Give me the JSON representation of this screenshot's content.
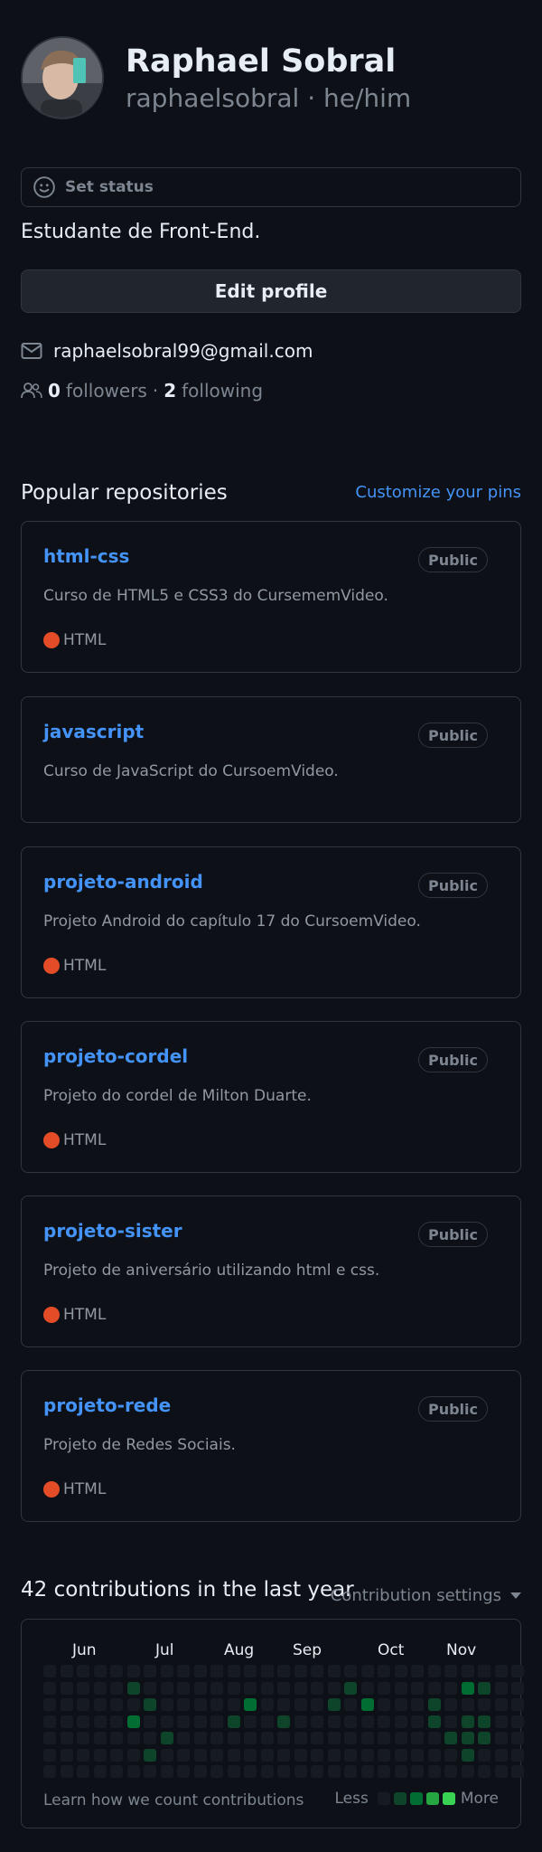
{
  "profile": {
    "name": "Raphael Sobral",
    "login_line": "raphaelsobral · he/him",
    "set_status": "Set status",
    "bio": "Estudante de Front-End.",
    "edit_profile": "Edit profile",
    "email": "raphaelsobral99@gmail.com",
    "followers_count": "0",
    "followers_label": "followers",
    "following_count": "2",
    "following_label": "following"
  },
  "pinned": {
    "title": "Popular repositories",
    "customize": "Customize your pins",
    "repos": [
      {
        "name": "html-css",
        "visibility": "Public",
        "description": "Curso de HTML5 e CSS3 do CursememVideo.",
        "language": "HTML"
      },
      {
        "name": "javascript",
        "visibility": "Public",
        "description": "Curso de JavaScript do CursoemVideo.",
        "language": ""
      },
      {
        "name": "projeto-android",
        "visibility": "Public",
        "description": "Projeto Android do capítulo 17 do CursoemVideo.",
        "language": "HTML"
      },
      {
        "name": "projeto-cordel",
        "visibility": "Public",
        "description": "Projeto do cordel de Milton Duarte.",
        "language": "HTML"
      },
      {
        "name": "projeto-sister",
        "visibility": "Public",
        "description": "Projeto de aniversário utilizando html e css.",
        "language": "HTML"
      },
      {
        "name": "projeto-rede",
        "visibility": "Public",
        "description": "Projeto de Redes Sociais.",
        "language": "HTML"
      }
    ],
    "language_color": "#e34c26"
  },
  "contributions": {
    "title": "42 contributions in the last year",
    "settings": "Contribution settings",
    "months": [
      "Jun",
      "Jul",
      "Aug",
      "Sep",
      "Oct",
      "Nov"
    ],
    "learn": "Learn how we count contributions",
    "less": "Less",
    "more": "More",
    "colors": [
      "#161b22",
      "#0e4429",
      "#006d32",
      "#26a641",
      "#39d353"
    ],
    "active_days": [
      {
        "week": 5,
        "day": 1,
        "level": 1
      },
      {
        "week": 6,
        "day": 2,
        "level": 1
      },
      {
        "week": 5,
        "day": 3,
        "level": 2
      },
      {
        "week": 7,
        "day": 4,
        "level": 1
      },
      {
        "week": 6,
        "day": 5,
        "level": 1
      },
      {
        "week": 11,
        "day": 3,
        "level": 1
      },
      {
        "week": 12,
        "day": 2,
        "level": 2
      },
      {
        "week": 14,
        "day": 3,
        "level": 1
      },
      {
        "week": 17,
        "day": 2,
        "level": 1
      },
      {
        "week": 18,
        "day": 1,
        "level": 1
      },
      {
        "week": 19,
        "day": 2,
        "level": 2
      },
      {
        "week": 23,
        "day": 2,
        "level": 1
      },
      {
        "week": 23,
        "day": 3,
        "level": 1
      },
      {
        "week": 24,
        "day": 4,
        "level": 1
      },
      {
        "week": 25,
        "day": 1,
        "level": 2
      },
      {
        "week": 26,
        "day": 1,
        "level": 1
      },
      {
        "week": 25,
        "day": 3,
        "level": 1
      },
      {
        "week": 26,
        "day": 3,
        "level": 1
      },
      {
        "week": 25,
        "day": 4,
        "level": 1
      },
      {
        "week": 26,
        "day": 4,
        "level": 1
      },
      {
        "week": 25,
        "day": 5,
        "level": 1
      }
    ]
  }
}
